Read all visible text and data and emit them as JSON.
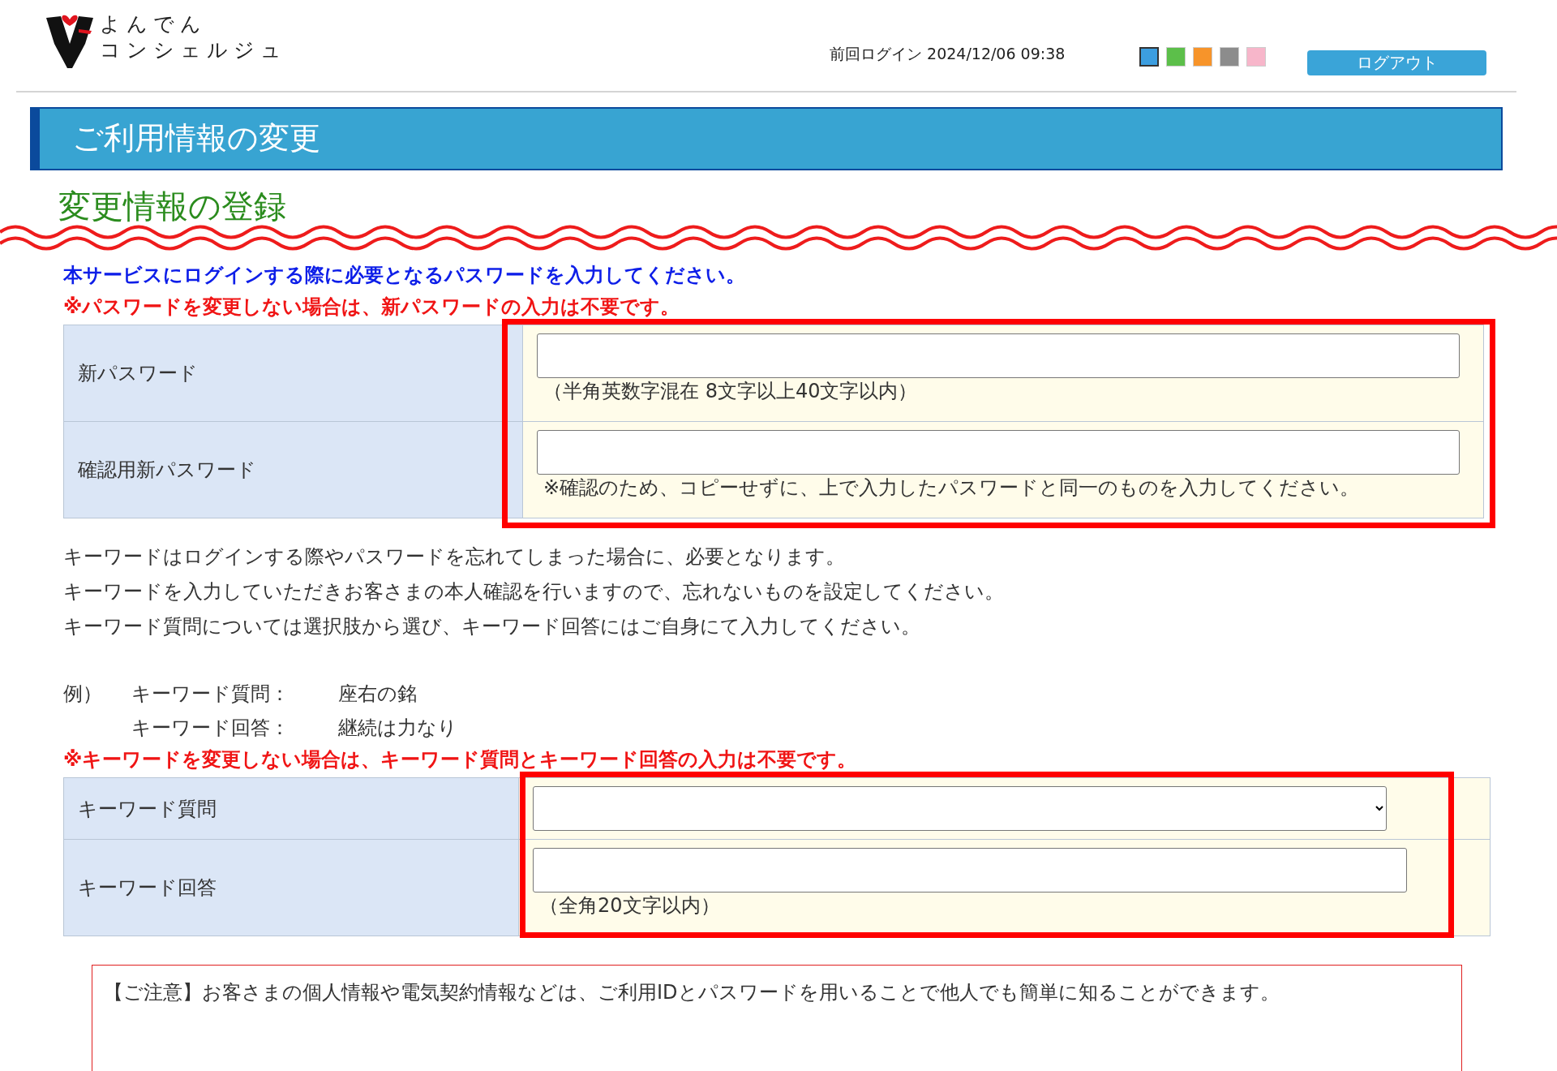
{
  "header": {
    "logo_lines": [
      "よんでん",
      "コンシェルジュ"
    ],
    "last_login": "前回ログイン 2024/12/06 09:38",
    "theme_swatches": [
      {
        "color": "#3c9ee0",
        "selected": true
      },
      {
        "color": "#5cbf4a",
        "selected": false
      },
      {
        "color": "#f7942a",
        "selected": false
      },
      {
        "color": "#8c8c8c",
        "selected": false
      },
      {
        "color": "#f7b6ca",
        "selected": false
      }
    ],
    "logout_button": "ログアウト"
  },
  "page_title": "ご利用情報の変更",
  "section_title": "変更情報の登録",
  "password_section": {
    "intro": "本サービスにログインする際に必要となるパスワードを入力してください。",
    "warning": "※パスワードを変更しない場合は、新パスワードの入力は不要です。",
    "rows": [
      {
        "label": "新パスワード",
        "kind": "input",
        "hint": "（半角英数字混在 8文字以上40文字以内）"
      },
      {
        "label": "確認用新パスワード",
        "kind": "input",
        "hint": "※確認のため、コピーせずに、上で入力したパスワードと同一のものを入力してください。"
      }
    ]
  },
  "keyword_section": {
    "paragraphs": [
      "キーワードはログインする際やパスワードを忘れてしまった場合に、必要となります。",
      "キーワードを入力していただきお客さまの本人確認を行いますので、忘れないものを設定してください。",
      "キーワード質問については選択肢から選び、キーワード回答にはご自身にて入力してください。"
    ],
    "example": {
      "prefix": "例）",
      "lines": [
        {
          "term": "キーワード質問：",
          "value": "座右の銘"
        },
        {
          "term": "キーワード回答：",
          "value": "継続は力なり"
        }
      ]
    },
    "warning": "※キーワードを変更しない場合は、キーワード質問とキーワード回答の入力は不要です。",
    "rows": [
      {
        "label": "キーワード質問",
        "kind": "select"
      },
      {
        "label": "キーワード回答",
        "kind": "input",
        "hint": "（全角20文字以内）"
      }
    ]
  },
  "notice": "【ご注意】お客さまの個人情報や電気契約情報などは、ご利用IDとパスワードを用いることで他人でも簡単に知ることができます。"
}
